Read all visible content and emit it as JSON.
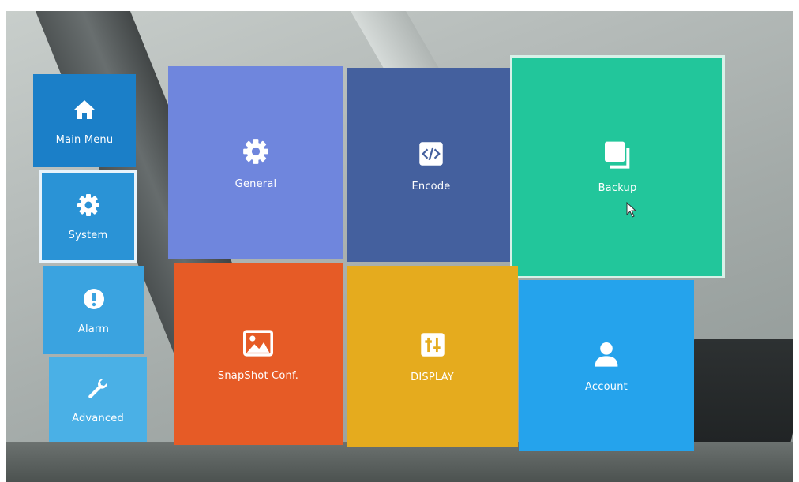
{
  "sidebar": {
    "items": [
      {
        "label": "Main Menu",
        "icon": "home-icon"
      },
      {
        "label": "System",
        "icon": "gear-icon",
        "selected": true
      },
      {
        "label": "Alarm",
        "icon": "alert-icon"
      },
      {
        "label": "Advanced",
        "icon": "wrench-icon"
      }
    ]
  },
  "tiles": [
    {
      "label": "General",
      "icon": "gear-icon",
      "color": "#6f86dd"
    },
    {
      "label": "Encode",
      "icon": "code-icon",
      "color": "#44609e"
    },
    {
      "label": "Backup",
      "icon": "copy-icon",
      "color": "#22c69b",
      "selected": true
    },
    {
      "label": "SnapShot Conf.",
      "icon": "image-icon",
      "color": "#e65b26"
    },
    {
      "label": "DISPLAY",
      "icon": "display-settings-icon",
      "color": "#e5ab1e"
    },
    {
      "label": "Account",
      "icon": "user-icon",
      "color": "#25a3ec"
    }
  ],
  "colors": {
    "sidebar": "#1b7fc8",
    "selected_border": "#e8f3fb"
  }
}
